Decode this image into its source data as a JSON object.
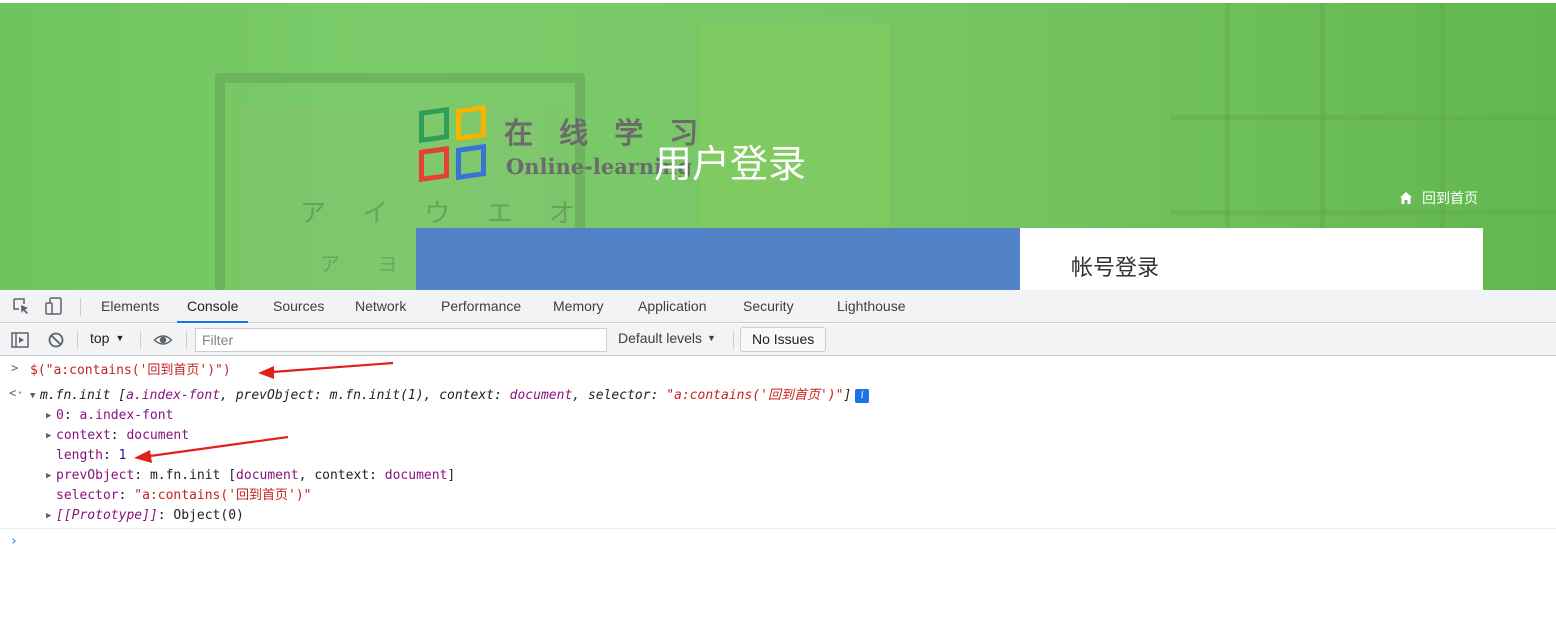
{
  "page": {
    "logo_cn": "在 线 学 习",
    "logo_en": "Online-learning",
    "title": "用户登录",
    "home_link": "回到首页",
    "account_login": "帐号登录",
    "bg_glyphs_1": "ア イ ウ エ オ",
    "bg_glyphs_2": "ア ヨ"
  },
  "devtools": {
    "tabs": [
      "Elements",
      "Console",
      "Sources",
      "Network",
      "Performance",
      "Memory",
      "Application",
      "Security",
      "Lighthouse"
    ],
    "active_tab": "Console",
    "context": "top",
    "filter_placeholder": "Filter",
    "default_levels": "Default levels",
    "issues": "No Issues"
  },
  "console": {
    "input": "$(\"a:contains('回到首页')\")",
    "result_head": {
      "ctor": "m.fn.init",
      "item": "a.index-font",
      "prev_key": "prevObject",
      "prev_val": "m.fn.init(1)",
      "context_key": "context",
      "context_val": "document",
      "selector_key": "selector",
      "selector_val": "\"a:contains('回到首页')\""
    },
    "props": {
      "p0_key": "0",
      "p0_val": "a.index-font",
      "context_key": "context",
      "context_val": "document",
      "length_key": "length",
      "length_val": "1",
      "prev_key": "prevObject",
      "prev_ctor": "m.fn.init",
      "prev_inner_doc": "document",
      "prev_inner_ckey": "context",
      "prev_inner_cval": "document",
      "selector_key": "selector",
      "selector_val": "\"a:contains('回到首页')\"",
      "proto_key": "[[Prototype]]",
      "proto_val": "Object(0)"
    }
  },
  "colors": {
    "accent": "#1a73e8",
    "annotation_arrow": "#e0201b",
    "page_green": "#78c766",
    "panel_blue": "#5183c6"
  }
}
